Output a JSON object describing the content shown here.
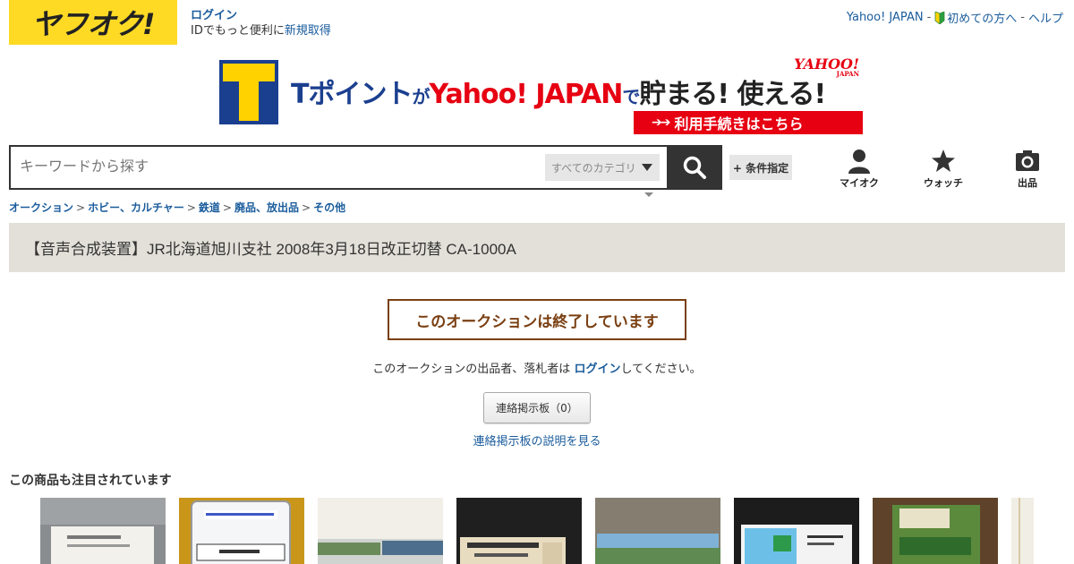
{
  "header": {
    "logo_text": "ヤフオク!",
    "login_label": "ログイン",
    "register_prefix": "IDでもっと便利に",
    "register_link": "新規取得",
    "top_links": {
      "yahoo_japan": "Yahoo! JAPAN",
      "sep": "-",
      "beginner": "初めての方へ",
      "help": "ヘルプ"
    }
  },
  "banner": {
    "t_point": "Tポイント",
    "ga": "が",
    "yahoo_japan": "Yahoo! JAPAN",
    "de": "で",
    "tamaru": "貯まる! 使える!",
    "yahoo_logo": "YAHOO!",
    "yahoo_logo_sub": "JAPAN",
    "cta_arrows": "➔➔",
    "cta": "利用手続きはこちら"
  },
  "search": {
    "placeholder": "キーワードから探す",
    "category": "すべてのカテゴリ",
    "condition_button": "+ 条件指定"
  },
  "nav": {
    "myauc": "マイオク",
    "watch": "ウォッチ",
    "sell": "出品"
  },
  "breadcrumb": {
    "items": [
      "オークション",
      "ホビー、カルチャー",
      "鉄道",
      "廃品、放出品",
      "その他"
    ],
    "separator": ">"
  },
  "item": {
    "title": "【音声合成装置】JR北海道旭川支社 2008年3月18日改正切替 CA-1000A"
  },
  "status": {
    "ended": "このオークションは終了しています",
    "notice_prefix": "このオークションの出品者、落札者は ",
    "notice_link": "ログイン",
    "notice_suffix": "してください。",
    "board_button": "連絡掲示板（0）",
    "board_help": "連絡掲示板の説明を見る"
  },
  "recommend": {
    "heading": "この商品も注目されています"
  },
  "colors": {
    "logo_bg": "#ffda25",
    "link": "#1a5c9c",
    "title_bar": "#e2e0d9",
    "ended": "#7a3f12",
    "brand_red": "#e60012",
    "brand_blue": "#1b3f8f"
  }
}
